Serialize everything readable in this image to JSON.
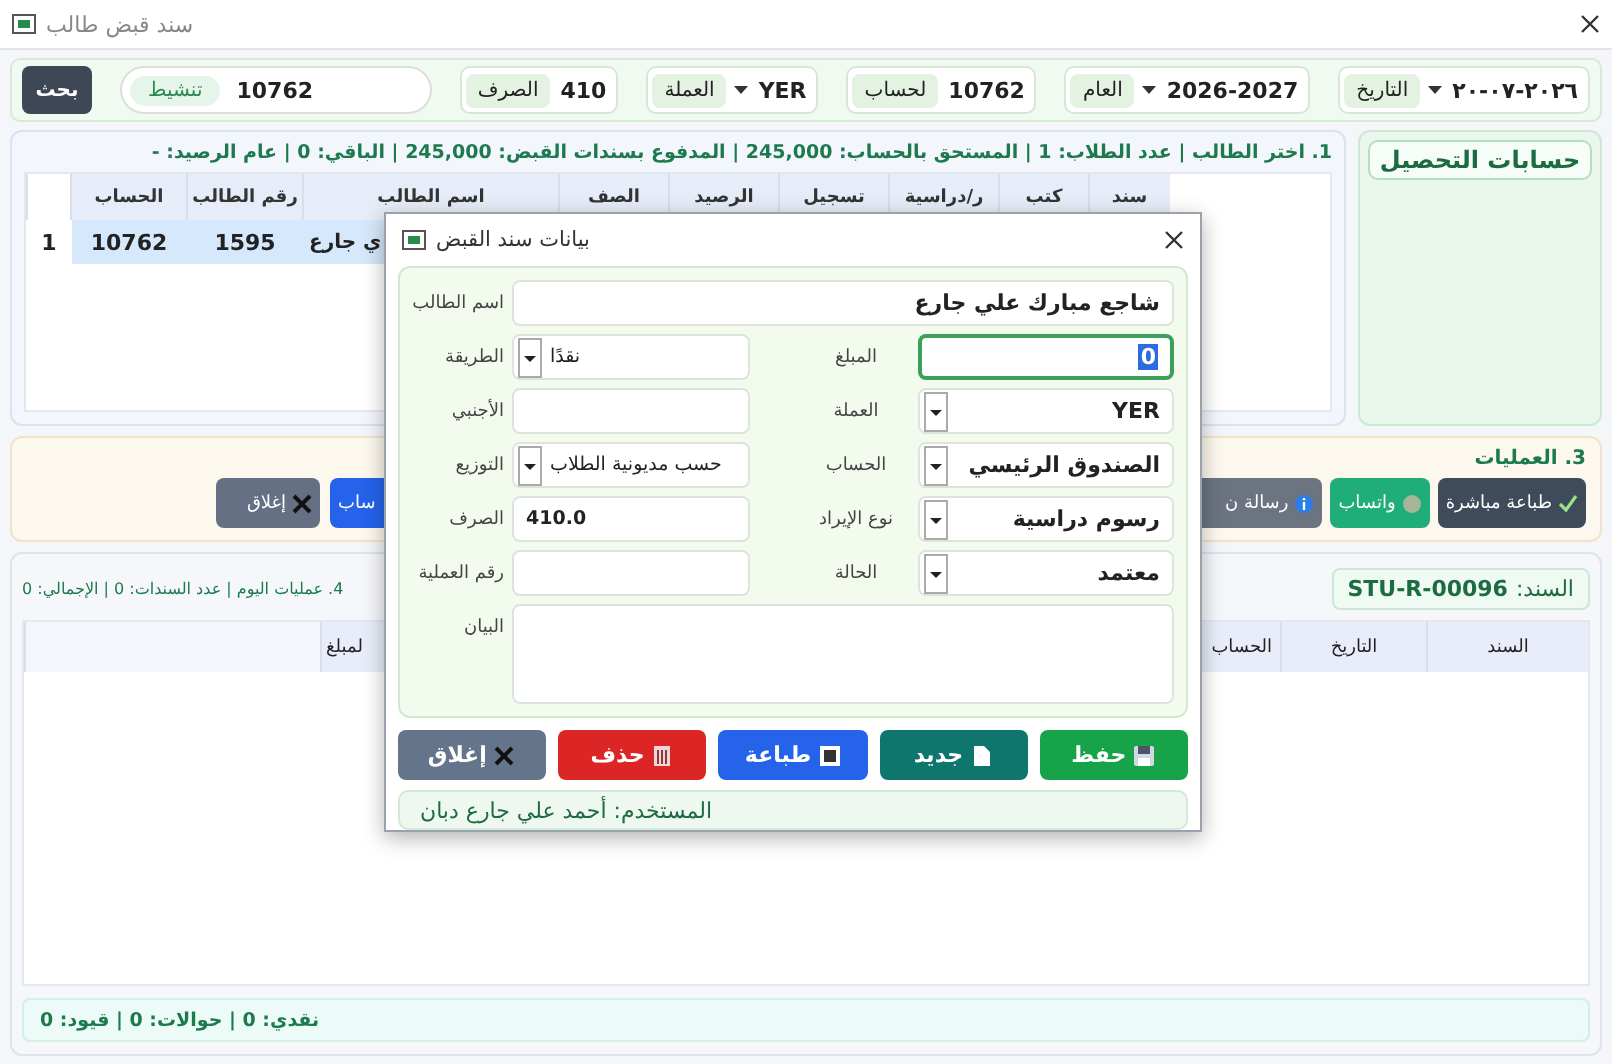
{
  "window": {
    "title": "سند قبض طالب"
  },
  "toolbar": {
    "fields": [
      {
        "kind": "combo",
        "label": "التاريخ",
        "value": "٢٠٢٦-٠٧-٢٠"
      },
      {
        "kind": "combo",
        "label": "العام",
        "value": "2026-2027"
      },
      {
        "kind": "text",
        "label": "لحساب",
        "value": "10762"
      },
      {
        "kind": "combo",
        "label": "العملة",
        "value": "YER"
      },
      {
        "kind": "text",
        "label": "الصرف",
        "value": "410"
      }
    ],
    "search": {
      "value": "10762",
      "chip": "تنشيط"
    },
    "search_button": "بحث"
  },
  "collection_accounts": {
    "title": "حسابات التحصيل"
  },
  "students": {
    "summary": "1. اختر الطالب | عدد الطلاب: 1 | المستحق بالحساب: 245,000 | المدفوع بسندات القبض: 245,000 | الباقي: 0 | عام الرصيد: -",
    "columns": [
      "سند",
      "كتب",
      "ر/دراسية",
      "تسجيل",
      "الرصيد",
      "الصف",
      "اسم الطالب",
      "رقم الطالب",
      "الحساب"
    ],
    "rows": [
      {
        "number": "1",
        "selected": true,
        "cells": [
          null,
          null,
          null,
          null,
          null,
          null,
          "ي جارع",
          "1595",
          "10762"
        ]
      }
    ]
  },
  "operations": {
    "title": "3. العمليات",
    "buttons": [
      {
        "kind": "print-direct",
        "label": "طباعة مباشرة"
      },
      {
        "kind": "whatsapp",
        "label": "واتساب"
      },
      {
        "kind": "message",
        "label": "رسالة ن"
      },
      {
        "kind": "primary",
        "label": "ساب"
      },
      {
        "kind": "close",
        "label": "إغلاق"
      }
    ]
  },
  "today": {
    "voucher": {
      "label": "السند:",
      "value": "STU-R-00096"
    },
    "summary": "4. عمليات اليوم | عدد السندات: 0 | الإجمالي: 0",
    "columns": [
      "السند",
      "التاريخ",
      "الحساب",
      "لمبلغ"
    ],
    "footer": "نقدي: 0 | حوالات: 0 | قيود: 0"
  },
  "dialog": {
    "title": "بيانات سند القبض",
    "fields": [
      {
        "kind": "wide",
        "label": "اسم الطالب",
        "value": "شاجع مبارك علي جارع",
        "focused": false
      },
      {
        "kind": "text",
        "label": "المبلغ",
        "value": "0",
        "focused": true
      },
      {
        "kind": "combo",
        "label": "الطريقة",
        "value": "نقدًا",
        "focused": false
      },
      {
        "kind": "combo",
        "label": "العملة",
        "value": "YER",
        "focused": false
      },
      {
        "kind": "text",
        "label": "الأجنبي",
        "focused": false
      },
      {
        "kind": "combo",
        "label": "الحساب",
        "value": "الصندوق الرئيسي",
        "focused": false
      },
      {
        "kind": "combo",
        "label": "التوزيع",
        "value": "حسب مديونية الطلاب",
        "focused": false
      },
      {
        "kind": "combo",
        "label": "نوع الإيراد",
        "value": "رسوم دراسية",
        "focused": false
      },
      {
        "kind": "text",
        "label": "الصرف",
        "value": "410.0",
        "focused": false
      },
      {
        "kind": "combo",
        "label": "الحالة",
        "value": "معتمد",
        "focused": false
      },
      {
        "kind": "text",
        "label": "رقم العملية",
        "focused": false
      },
      {
        "kind": "textarea",
        "label": "البيان",
        "focused": false
      }
    ],
    "buttons": [
      {
        "kind": "save",
        "label": "حفظ"
      },
      {
        "kind": "new",
        "label": "جديد"
      },
      {
        "kind": "print",
        "label": "طباعة"
      },
      {
        "kind": "delete",
        "label": "حذف"
      },
      {
        "kind": "close",
        "label": "إغلاق"
      }
    ],
    "user": "المستخدم: أحمد علي جارع دبان"
  }
}
